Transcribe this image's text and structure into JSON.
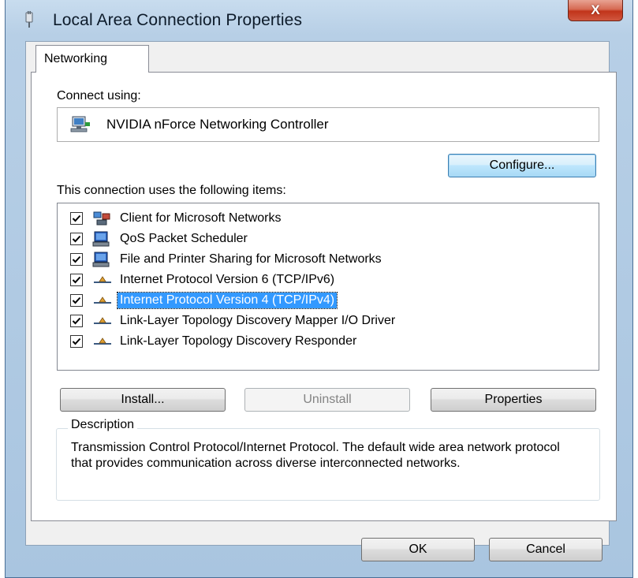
{
  "window": {
    "title": "Local Area Connection Properties",
    "close_label": "X"
  },
  "tabs": [
    {
      "label": "Networking",
      "selected": true
    }
  ],
  "connect_using": {
    "label": "Connect using:",
    "adapter": "NVIDIA nForce Networking Controller",
    "adapter_icon": "network-adapter-icon",
    "configure_button": "Configure..."
  },
  "items_section": {
    "label": "This connection uses the following items:",
    "items": [
      {
        "label": "Client for Microsoft Networks",
        "checked": true,
        "icon": "client-network-icon",
        "selected": false
      },
      {
        "label": "QoS Packet Scheduler",
        "checked": true,
        "icon": "service-icon",
        "selected": false
      },
      {
        "label": "File and Printer Sharing for Microsoft Networks",
        "checked": true,
        "icon": "service-icon",
        "selected": false
      },
      {
        "label": "Internet Protocol Version 6 (TCP/IPv6)",
        "checked": true,
        "icon": "protocol-icon",
        "selected": false
      },
      {
        "label": "Internet Protocol Version 4 (TCP/IPv4)",
        "checked": true,
        "icon": "protocol-icon",
        "selected": true
      },
      {
        "label": "Link-Layer Topology Discovery Mapper I/O Driver",
        "checked": true,
        "icon": "protocol-icon",
        "selected": false
      },
      {
        "label": "Link-Layer Topology Discovery Responder",
        "checked": true,
        "icon": "protocol-icon",
        "selected": false
      }
    ]
  },
  "action_buttons": {
    "install": "Install...",
    "uninstall": "Uninstall",
    "properties": "Properties"
  },
  "description": {
    "legend": "Description",
    "text": "Transmission Control Protocol/Internet Protocol. The default wide area network protocol that provides communication across diverse interconnected networks."
  },
  "dialog_buttons": {
    "ok": "OK",
    "cancel": "Cancel"
  },
  "colors": {
    "selection": "#3399ff",
    "close_button": "#c1341a",
    "title_glass": "#b7cfe6"
  }
}
